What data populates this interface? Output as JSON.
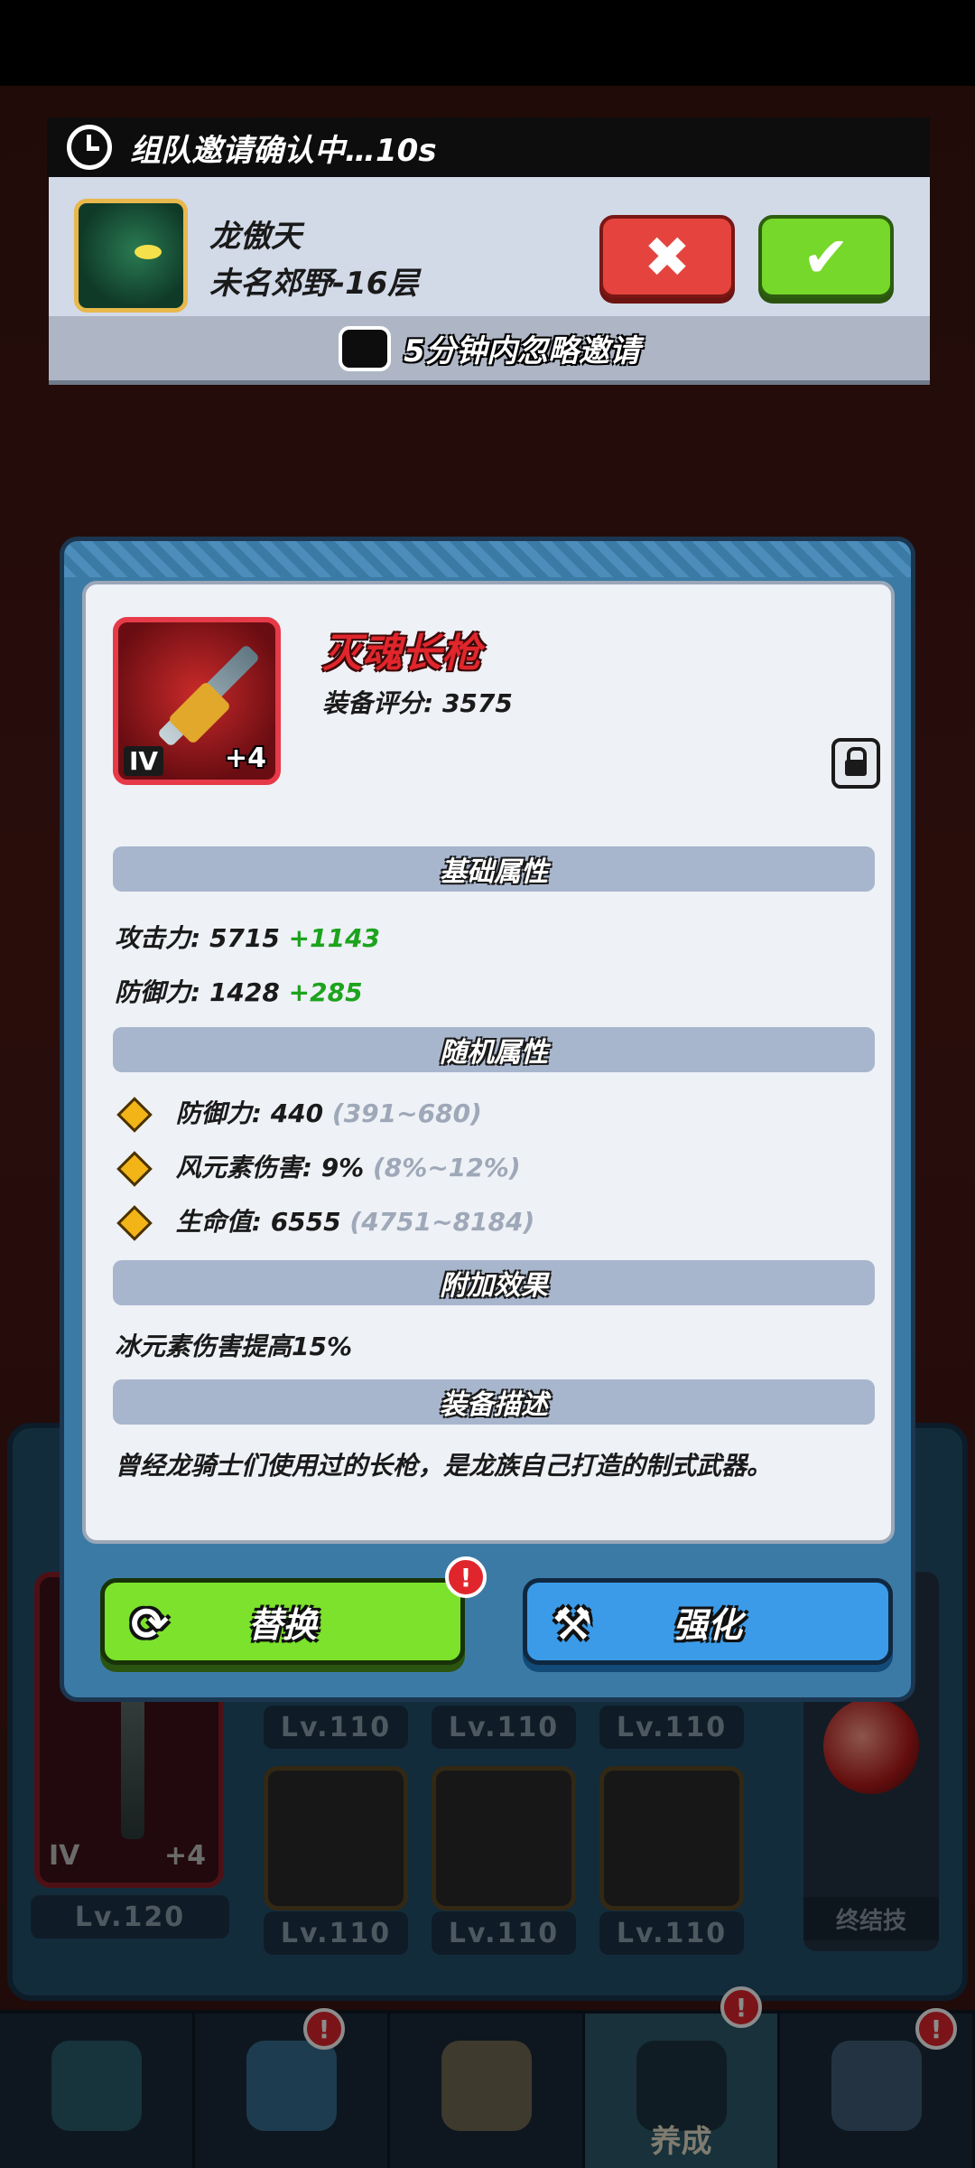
{
  "invite": {
    "title": "组队邀请确认中…10s",
    "inviter_name": "龙傲天",
    "inviter_location": "未名郊野-16层",
    "reject_icon": "✖",
    "accept_icon": "✔",
    "ignore_label": "5分钟内忽略邀请"
  },
  "item": {
    "name": "灭魂长枪",
    "score_label": "装备评分: 3575",
    "tier": "IV",
    "enhance_level": "+4"
  },
  "sections": {
    "base": "基础属性",
    "random": "随机属性",
    "extra": "附加效果",
    "desc": "装备描述"
  },
  "base_stats": [
    {
      "label": "攻击力:",
      "value": "5715",
      "bonus": "+1143"
    },
    {
      "label": "防御力:",
      "value": "1428",
      "bonus": "+285"
    }
  ],
  "random_stats": [
    {
      "label": "防御力:",
      "value": "440",
      "range": "(391~680)"
    },
    {
      "label": "风元素伤害:",
      "value": "9%",
      "range": "(8%~12%)"
    },
    {
      "label": "生命值:",
      "value": "6555",
      "range": "(4751~8184)"
    }
  ],
  "extra_effect": "冰元素伤害提高15%",
  "description": "曾经龙骑士们使用过的长枪，是龙族自己打造的制式武器。",
  "buttons": {
    "replace": "替换",
    "enhance": "强化",
    "replace_icon": "⟳",
    "enhance_icon": "⚒"
  },
  "badge": "!",
  "background": {
    "big_tier": "IV",
    "big_plus": "+4",
    "big_level": "Lv.120",
    "level_110": "Lv.110",
    "ultimate_label": "终结技",
    "nav_active_label": "养成"
  },
  "colors": {
    "item_name": "#e0262c",
    "bonus_green": "#1da31d",
    "accept_green": "#76d82a",
    "reject_red": "#e5443e",
    "enhance_blue": "#3b9be8"
  }
}
